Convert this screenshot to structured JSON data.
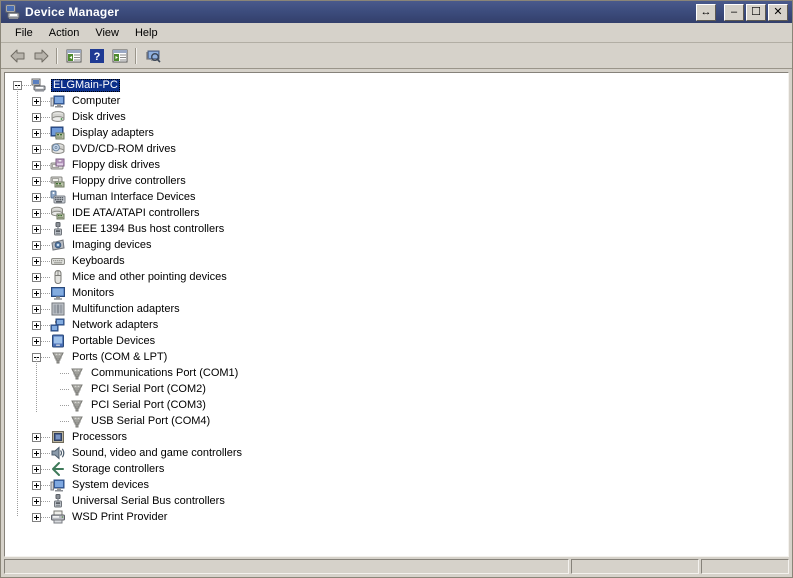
{
  "window": {
    "title": "Device Manager",
    "title_icon": "device-manager-icon",
    "buttons": {
      "sizer": "↔",
      "minimize": "–",
      "maximize": "☐",
      "close": "✕"
    }
  },
  "menubar": {
    "items": [
      {
        "label": "File"
      },
      {
        "label": "Action"
      },
      {
        "label": "View"
      },
      {
        "label": "Help"
      }
    ]
  },
  "toolbar": {
    "items": [
      {
        "name": "back-arrow-icon",
        "tooltip": "Back"
      },
      {
        "name": "forward-arrow-icon",
        "tooltip": "Forward"
      },
      {
        "name": "separator-1",
        "tooltip": ""
      },
      {
        "name": "show-hide-console-tree-icon",
        "tooltip": "Show/Hide Console Tree"
      },
      {
        "name": "help-icon",
        "tooltip": "Help"
      },
      {
        "name": "properties-icon",
        "tooltip": "Properties"
      },
      {
        "name": "separator-2",
        "tooltip": ""
      },
      {
        "name": "scan-for-hardware-changes-icon",
        "tooltip": "Scan for hardware changes"
      }
    ]
  },
  "tree": {
    "root": {
      "label": "ELGMain-PC",
      "icon": "computer-node-icon",
      "expanded": true,
      "selected": true
    },
    "nodes": [
      {
        "label": "Computer",
        "icon": "computer-icon",
        "expanded": false,
        "level": 1
      },
      {
        "label": "Disk drives",
        "icon": "disk-drive-icon",
        "expanded": false,
        "level": 1
      },
      {
        "label": "Display adapters",
        "icon": "display-adapter-icon",
        "expanded": false,
        "level": 1
      },
      {
        "label": "DVD/CD-ROM drives",
        "icon": "dvd-cdrom-icon",
        "expanded": false,
        "level": 1
      },
      {
        "label": "Floppy disk drives",
        "icon": "floppy-disk-icon",
        "expanded": false,
        "level": 1
      },
      {
        "label": "Floppy drive controllers",
        "icon": "floppy-controller-icon",
        "expanded": false,
        "level": 1
      },
      {
        "label": "Human Interface Devices",
        "icon": "hid-icon",
        "expanded": false,
        "level": 1
      },
      {
        "label": "IDE ATA/ATAPI controllers",
        "icon": "ide-controller-icon",
        "expanded": false,
        "level": 1
      },
      {
        "label": "IEEE 1394 Bus host controllers",
        "icon": "ieee1394-icon",
        "expanded": false,
        "level": 1
      },
      {
        "label": "Imaging devices",
        "icon": "imaging-device-icon",
        "expanded": false,
        "level": 1
      },
      {
        "label": "Keyboards",
        "icon": "keyboard-icon",
        "expanded": false,
        "level": 1
      },
      {
        "label": "Mice and other pointing devices",
        "icon": "mouse-icon",
        "expanded": false,
        "level": 1
      },
      {
        "label": "Monitors",
        "icon": "monitor-icon",
        "expanded": false,
        "level": 1
      },
      {
        "label": "Multifunction adapters",
        "icon": "multifunction-adapter-icon",
        "expanded": false,
        "level": 1
      },
      {
        "label": "Network adapters",
        "icon": "network-adapter-icon",
        "expanded": false,
        "level": 1
      },
      {
        "label": "Portable Devices",
        "icon": "portable-device-icon",
        "expanded": false,
        "level": 1
      },
      {
        "label": "Ports (COM & LPT)",
        "icon": "port-icon",
        "expanded": true,
        "level": 1
      },
      {
        "label": "Communications Port (COM1)",
        "icon": "port-icon",
        "leaf": true,
        "level": 2
      },
      {
        "label": "PCI Serial Port (COM2)",
        "icon": "port-icon",
        "leaf": true,
        "level": 2
      },
      {
        "label": "PCI Serial Port (COM3)",
        "icon": "port-icon",
        "leaf": true,
        "level": 2
      },
      {
        "label": "USB Serial Port (COM4)",
        "icon": "port-icon",
        "leaf": true,
        "level": 2
      },
      {
        "label": "Processors",
        "icon": "processor-icon",
        "expanded": false,
        "level": 1
      },
      {
        "label": "Sound, video and game controllers",
        "icon": "sound-controller-icon",
        "expanded": false,
        "level": 1
      },
      {
        "label": "Storage controllers",
        "icon": "storage-controller-icon",
        "expanded": false,
        "level": 1
      },
      {
        "label": "System devices",
        "icon": "system-device-icon",
        "expanded": false,
        "level": 1
      },
      {
        "label": "Universal Serial Bus controllers",
        "icon": "usb-controller-icon",
        "expanded": false,
        "level": 1
      },
      {
        "label": "WSD Print Provider",
        "icon": "printer-icon",
        "expanded": false,
        "level": 1
      }
    ]
  },
  "statusbar": {
    "panes": [
      "",
      "",
      ""
    ]
  },
  "colors": {
    "titlebar": "#3d4d7e",
    "chrome": "#d6d2ca",
    "selection": "#0b2f8a",
    "panel": "#ffffff",
    "treeline": "#9d9d9d"
  }
}
